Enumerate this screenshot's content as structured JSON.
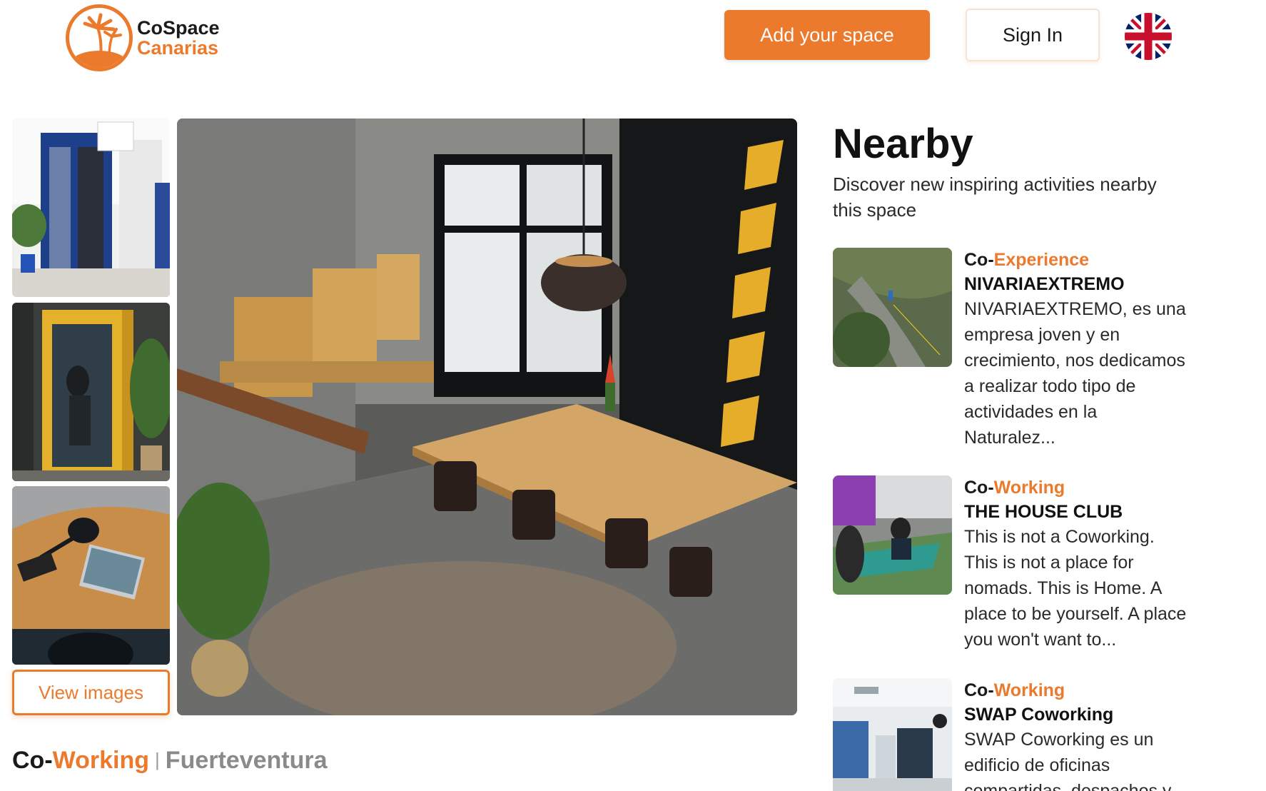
{
  "brand": {
    "line1": "CoSpace",
    "line2": "Canarias",
    "accent_color": "#ec7a2c"
  },
  "header": {
    "add_space_label": "Add your space",
    "sign_in_label": "Sign In",
    "language_icon": "uk-flag-icon"
  },
  "gallery": {
    "view_images_label": "View images"
  },
  "space": {
    "prefix": "Co-",
    "type": "Working",
    "location": "Fuerteventura"
  },
  "nearby": {
    "title": "Nearby",
    "subtitle": "Discover new inspiring activities nearby this space",
    "items": [
      {
        "prefix": "Co-",
        "type": "Experience",
        "name": "NIVARIAEXTREMO",
        "description": "NIVARIAEXTREMO, es una empresa joven y en crecimiento, nos dedicamos a realizar todo tipo de actividades en la Naturalez..."
      },
      {
        "prefix": "Co-",
        "type": "Working",
        "name": "THE HOUSE CLUB",
        "description": "This is not a Coworking. This is not a place for nomads. This is Home. A place to be yourself. A place you won't want to..."
      },
      {
        "prefix": "Co-",
        "type": "Working",
        "name": "SWAP Coworking",
        "description": "SWAP Coworking es un edificio de oficinas compartidas, despachos y..."
      }
    ]
  }
}
